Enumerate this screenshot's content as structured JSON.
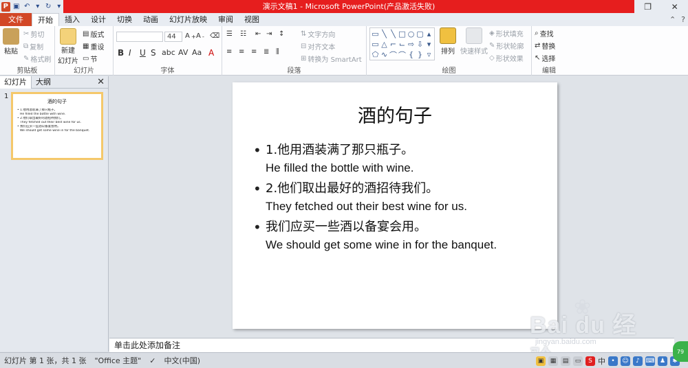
{
  "window": {
    "title": "演示文稿1 - Microsoft PowerPoint(产品激活失败)",
    "help": "?"
  },
  "tabs": [
    "文件",
    "开始",
    "插入",
    "设计",
    "切换",
    "动画",
    "幻灯片放映",
    "审阅",
    "视图"
  ],
  "ribbon": {
    "clipboard": {
      "paste": "粘贴",
      "cut": "剪切",
      "copy": "复制",
      "format_painter": "格式刷",
      "label": "剪贴板"
    },
    "slides": {
      "new_slide_1": "新建",
      "new_slide_2": "幻灯片",
      "layout": "版式",
      "reset": "重设",
      "section": "节",
      "label": "幻灯片"
    },
    "font": {
      "font_size": "44",
      "label": "字体"
    },
    "paragraph": {
      "text_direction": "文字方向",
      "align_text": "对齐文本",
      "smartart": "转换为 SmartArt",
      "label": "段落"
    },
    "drawing": {
      "arrange": "排列",
      "quick_styles": "快速样式",
      "shape_fill": "形状填充",
      "shape_outline": "形状轮廓",
      "shape_effects": "形状效果",
      "label": "绘图"
    },
    "editing": {
      "find": "查找",
      "replace": "替换",
      "select": "选择",
      "label": "编辑"
    }
  },
  "panel": {
    "tab_slides": "幻灯片",
    "tab_outline": "大纲",
    "slide_number": "1"
  },
  "thumbnail": {
    "title": "酒的句子",
    "lines": [
      "• 1.他用酒装满了那只瓶子。",
      "He filled the bottle with wine.",
      "• 2.他们取出最好的酒招待我们。",
      "They fetched out their best wine for us.",
      "• 我们应买一些酒以备宴会用。",
      "We should get some wine in for the banquet."
    ]
  },
  "slide": {
    "title": "酒的句子",
    "bullets": [
      {
        "cn": "1.他用酒装满了那只瓶子。",
        "en": "He filled the bottle with wine."
      },
      {
        "cn": "2.他们取出最好的酒招待我们。",
        "en": "They fetched out their best wine for us."
      },
      {
        "cn": "我们应买一些酒以备宴会用。",
        "en": "We should get some wine in for the banquet."
      }
    ]
  },
  "notes": {
    "placeholder": "单击此处添加备注"
  },
  "watermark": {
    "brand": "Bai du 经验",
    "url": "jingyan.baidu.com"
  },
  "status": {
    "slide_info": "幻灯片 第 1 张，共 1 张",
    "theme": "\"Office 主题\"",
    "language": "中文(中国)",
    "ime": "中",
    "zoom_badge": "79"
  },
  "colors": {
    "file_tab": "#d24726",
    "title_bar_red": "#e61e1e",
    "thumb_border": "#f5c86a"
  }
}
